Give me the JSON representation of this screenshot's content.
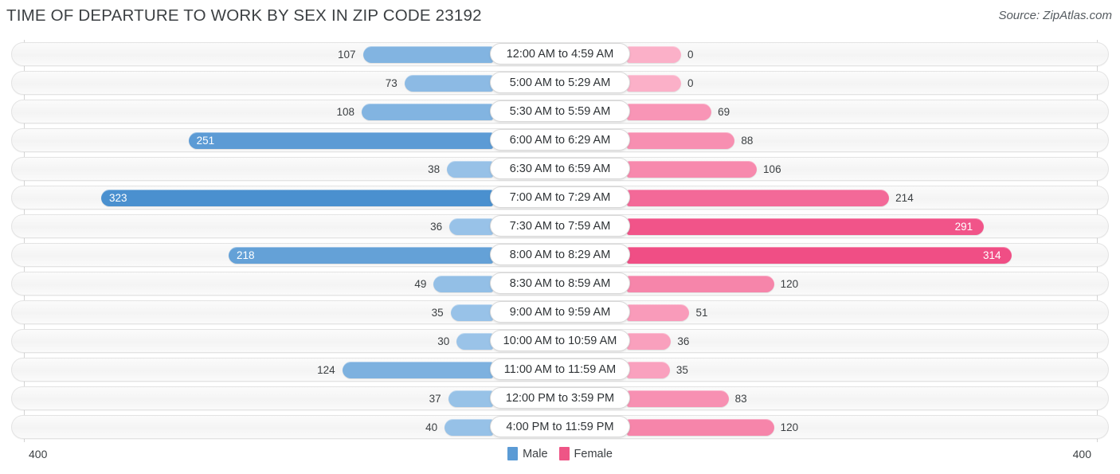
{
  "header": {
    "title": "TIME OF DEPARTURE TO WORK BY SEX IN ZIP CODE 23192",
    "source": "Source: ZipAtlas.com"
  },
  "footer": {
    "axis_left_label": "400",
    "axis_right_label": "400",
    "legend": [
      {
        "label": "Male",
        "color": "#5b9bd5"
      },
      {
        "label": "Female",
        "color": "#ee5586"
      }
    ]
  },
  "colors": {
    "male_min": "#a6cbec",
    "male_max": "#5b9bd5",
    "female_min": "#fbb0c8",
    "female_max": "#f04e85",
    "track": "#f5f5f5",
    "axis": "#d4d4d4"
  },
  "chart_data": {
    "type": "bar",
    "subtype": "diverging-bidirectional",
    "title": "TIME OF DEPARTURE TO WORK BY SEX IN ZIP CODE 23192",
    "xlabel": "",
    "ylabel": "",
    "axis_max": 400,
    "xlim": [
      -400,
      400
    ],
    "grid": false,
    "legend_position": "bottom-center",
    "categories": [
      "12:00 AM to 4:59 AM",
      "5:00 AM to 5:29 AM",
      "5:30 AM to 5:59 AM",
      "6:00 AM to 6:29 AM",
      "6:30 AM to 6:59 AM",
      "7:00 AM to 7:29 AM",
      "7:30 AM to 7:59 AM",
      "8:00 AM to 8:29 AM",
      "8:30 AM to 8:59 AM",
      "9:00 AM to 9:59 AM",
      "10:00 AM to 10:59 AM",
      "11:00 AM to 11:59 AM",
      "12:00 PM to 3:59 PM",
      "4:00 PM to 11:59 PM"
    ],
    "series": [
      {
        "name": "Male",
        "color": "#5b9bd5",
        "values": [
          107,
          73,
          108,
          251,
          38,
          323,
          36,
          218,
          49,
          35,
          30,
          124,
          37,
          40
        ]
      },
      {
        "name": "Female",
        "color": "#ee5586",
        "values": [
          0,
          0,
          69,
          88,
          106,
          214,
          291,
          314,
          120,
          51,
          36,
          35,
          83,
          120
        ]
      }
    ]
  }
}
